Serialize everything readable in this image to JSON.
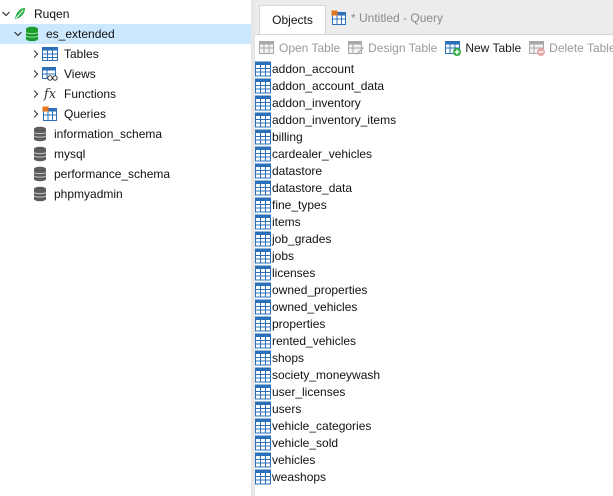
{
  "nav": {
    "connection": "Ruqen",
    "database": "es_extended",
    "children": [
      "Tables",
      "Views",
      "Functions",
      "Queries"
    ],
    "other_databases": [
      "information_schema",
      "mysql",
      "performance_schema",
      "phpmyadmin"
    ]
  },
  "tabs": {
    "objects": "Objects",
    "query": "* Untitled - Query"
  },
  "toolbar": {
    "open_table": "Open Table",
    "design_table": "Design Table",
    "new_table": "New Table",
    "delete_table": "Delete Table"
  },
  "tables": [
    "addon_account",
    "addon_account_data",
    "addon_inventory",
    "addon_inventory_items",
    "billing",
    "cardealer_vehicles",
    "datastore",
    "datastore_data",
    "fine_types",
    "items",
    "job_grades",
    "jobs",
    "licenses",
    "owned_properties",
    "owned_vehicles",
    "properties",
    "rented_vehicles",
    "shops",
    "society_moneywash",
    "user_licenses",
    "users",
    "vehicle_categories",
    "vehicle_sold",
    "vehicles",
    "weashops"
  ],
  "colors": {
    "selection": "#cce8ff",
    "db_active": "#1a9c2f",
    "db_inactive": "#5c5c5c",
    "table_icon": "#2a6fb8"
  }
}
